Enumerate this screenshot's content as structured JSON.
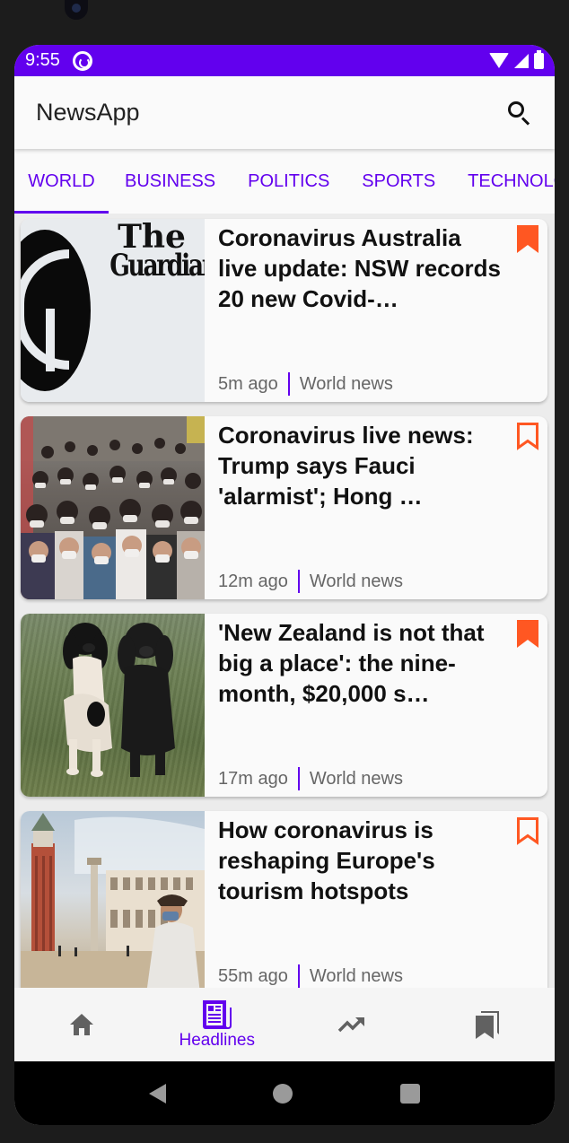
{
  "statusbar": {
    "time": "9:55"
  },
  "appbar": {
    "title": "NewsApp",
    "search_icon": "search-icon"
  },
  "tabs": [
    {
      "label": "WORLD",
      "active": true
    },
    {
      "label": "BUSINESS",
      "active": false
    },
    {
      "label": "POLITICS",
      "active": false
    },
    {
      "label": "SPORTS",
      "active": false
    },
    {
      "label": "TECHNOLOGY",
      "active": false
    }
  ],
  "articles": [
    {
      "title": "Coronavirus Australia live update: NSW records 20 new Covid-…",
      "time": "5m ago",
      "section": "World news",
      "bookmarked": true,
      "thumb_text": [
        "The",
        "Guardian"
      ]
    },
    {
      "title": "Coronavirus live news: Trump says Fauci 'alarmist'; Hong …",
      "time": "12m ago",
      "section": "World news",
      "bookmarked": false
    },
    {
      "title": "'New Zealand is not that big a place': the nine-month, $20,000 s…",
      "time": "17m ago",
      "section": "World news",
      "bookmarked": true
    },
    {
      "title": "How coronavirus is reshaping Europe's tourism hotspots",
      "time": "55m ago",
      "section": "World news",
      "bookmarked": false
    }
  ],
  "bottom_nav": [
    {
      "icon": "home-icon",
      "label": "",
      "active": false
    },
    {
      "icon": "newspaper-icon",
      "label": "Headlines",
      "active": true
    },
    {
      "icon": "trending-icon",
      "label": "",
      "active": false
    },
    {
      "icon": "bookmarks-icon",
      "label": "",
      "active": false
    }
  ],
  "colors": {
    "primary": "#6200ee",
    "bookmark": "#ff5722",
    "inactive_icon": "#616161"
  }
}
